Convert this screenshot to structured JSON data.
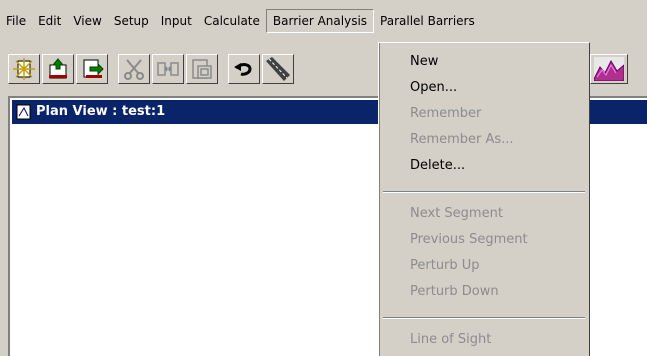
{
  "menubar": {
    "items": [
      "File",
      "Edit",
      "View",
      "Setup",
      "Input",
      "Calculate",
      "Barrier Analysis",
      "Parallel Barriers"
    ],
    "open_item": "Barrier Analysis"
  },
  "toolbar": {
    "icons": [
      "new-document-icon",
      "open-folder-icon",
      "save-icon",
      "cut-icon",
      "copy-icon",
      "paste-icon",
      "undo-icon",
      "road-icon",
      "terrain-icon"
    ]
  },
  "document": {
    "title": "Plan View : test:1"
  },
  "barrier_menu": {
    "items": [
      {
        "label": "New",
        "enabled": true
      },
      {
        "label": "Open...",
        "enabled": true
      },
      {
        "label": "Remember",
        "enabled": false
      },
      {
        "label": "Remember As...",
        "enabled": false
      },
      {
        "label": "Delete...",
        "enabled": true
      },
      {
        "label": "Next Segment",
        "enabled": false
      },
      {
        "label": "Previous Segment",
        "enabled": false
      },
      {
        "label": "Perturb Up",
        "enabled": false
      },
      {
        "label": "Perturb Down",
        "enabled": false
      },
      {
        "label": "Line of Sight",
        "enabled": false
      }
    ]
  },
  "colors": {
    "chrome": "#d4d0c8",
    "titlebar": "#0a246a",
    "disabled_text": "#8c8c8c"
  }
}
